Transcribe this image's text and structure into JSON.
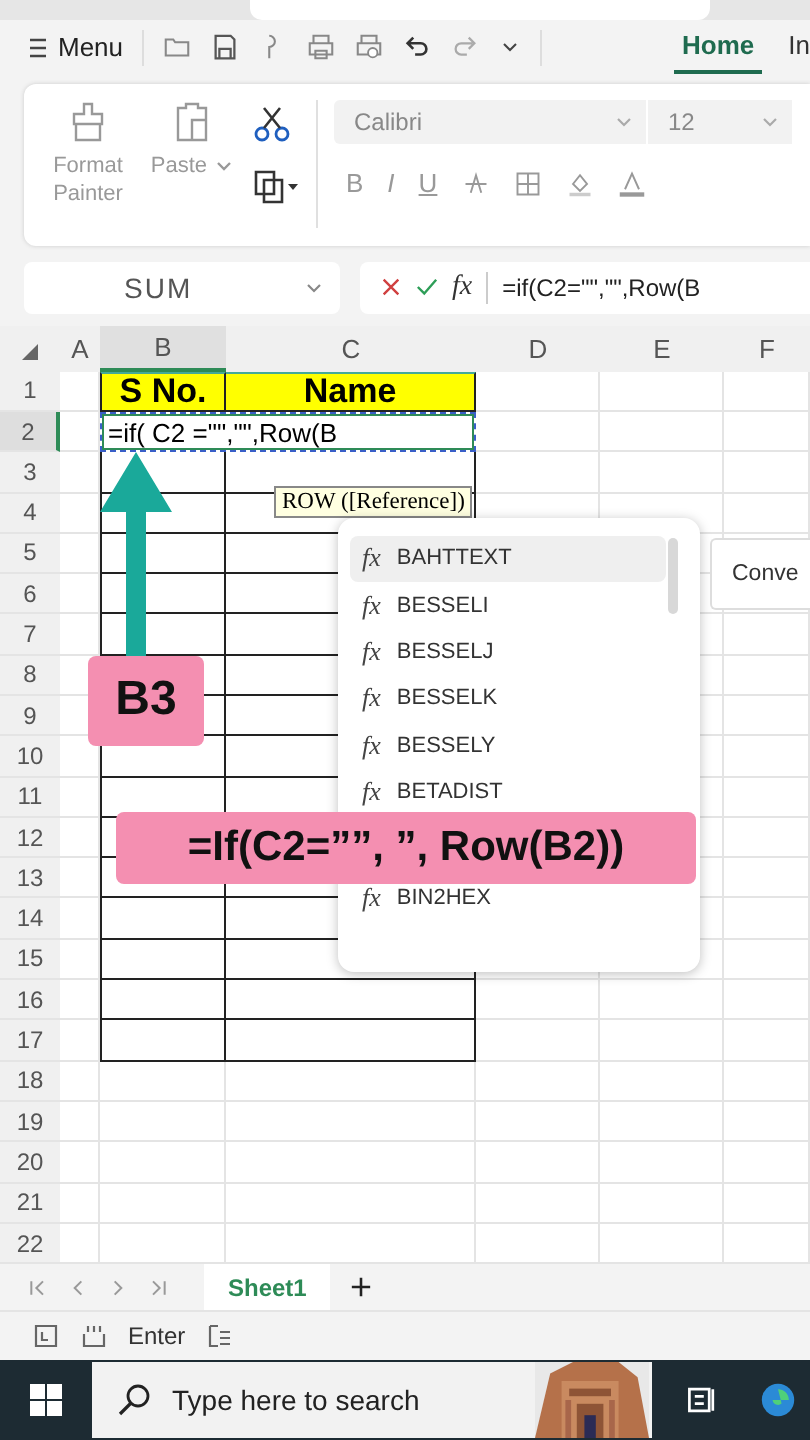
{
  "toolbar": {
    "menu_label": "Menu"
  },
  "ribbon_tabs": [
    {
      "label": "Home",
      "selected": true
    },
    {
      "label": "In",
      "selected": false
    }
  ],
  "clipboard": {
    "format_painter": "Format Painter",
    "paste": "Paste"
  },
  "font": {
    "name": "Calibri",
    "size": "12"
  },
  "format_buttons": [
    "B",
    "I",
    "U"
  ],
  "name_box": "SUM",
  "formula_bar": {
    "fx": "fx",
    "formula": "=if(C2=\"\",\"\",Row(B"
  },
  "columns": [
    {
      "label": "A",
      "selected": false
    },
    {
      "label": "B",
      "selected": true
    },
    {
      "label": "C",
      "selected": false
    },
    {
      "label": "D",
      "selected": false
    },
    {
      "label": "E",
      "selected": false
    },
    {
      "label": "F",
      "selected": false
    }
  ],
  "header_cells": [
    "S No.",
    "Name"
  ],
  "edit_cell": "=if( C2 =\"\",\"\",Row(B",
  "rows": [
    {
      "label": "1",
      "selected": false,
      "bordered": true
    },
    {
      "label": "2",
      "selected": true,
      "bordered": true
    },
    {
      "label": "3",
      "selected": false,
      "bordered": true
    },
    {
      "label": "4",
      "selected": false,
      "bordered": true
    },
    {
      "label": "5",
      "selected": false,
      "bordered": true
    },
    {
      "label": "6",
      "selected": false,
      "bordered": true
    },
    {
      "label": "7",
      "selected": false,
      "bordered": true
    },
    {
      "label": "8",
      "selected": false,
      "bordered": true
    },
    {
      "label": "9",
      "selected": false,
      "bordered": true
    },
    {
      "label": "10",
      "selected": false,
      "bordered": true
    },
    {
      "label": "11",
      "selected": false,
      "bordered": true
    },
    {
      "label": "12",
      "selected": false,
      "bordered": true
    },
    {
      "label": "13",
      "selected": false,
      "bordered": true
    },
    {
      "label": "14",
      "selected": false,
      "bordered": true
    },
    {
      "label": "15",
      "selected": false,
      "bordered": true
    },
    {
      "label": "16",
      "selected": false,
      "bordered": true
    },
    {
      "label": "17",
      "selected": false,
      "bordered": true
    },
    {
      "label": "18",
      "selected": false,
      "bordered": false
    },
    {
      "label": "19",
      "selected": false,
      "bordered": false
    },
    {
      "label": "20",
      "selected": false,
      "bordered": false
    },
    {
      "label": "21",
      "selected": false,
      "bordered": false
    },
    {
      "label": "22",
      "selected": false,
      "bordered": false
    }
  ],
  "tooltip": "ROW ([Reference])",
  "autocomplete": {
    "items": [
      {
        "icon": "fx",
        "label": "BAHTTEXT",
        "selected": true
      },
      {
        "icon": "fx",
        "label": "BESSELI",
        "selected": false
      },
      {
        "icon": "fx",
        "label": "BESSELJ",
        "selected": false
      },
      {
        "icon": "fx",
        "label": "BESSELK",
        "selected": false
      },
      {
        "icon": "fx",
        "label": "BESSELY",
        "selected": false
      },
      {
        "icon": "fx",
        "label": "BETADIST",
        "selected": false
      },
      {
        "icon": "fx",
        "label": "BIN2HEX",
        "selected": false
      }
    ]
  },
  "side_button": "Conve",
  "annotations": [
    {
      "kind": "label",
      "text": "B3"
    },
    {
      "kind": "banner",
      "text": "=If(C2=””, ”, Row(B2))"
    }
  ],
  "sheet_tabs": [
    {
      "label": "Sheet1",
      "selected": true
    }
  ],
  "status_bar": {
    "mode": "Enter"
  },
  "taskbar": {
    "search_placeholder": "Type here to search"
  }
}
